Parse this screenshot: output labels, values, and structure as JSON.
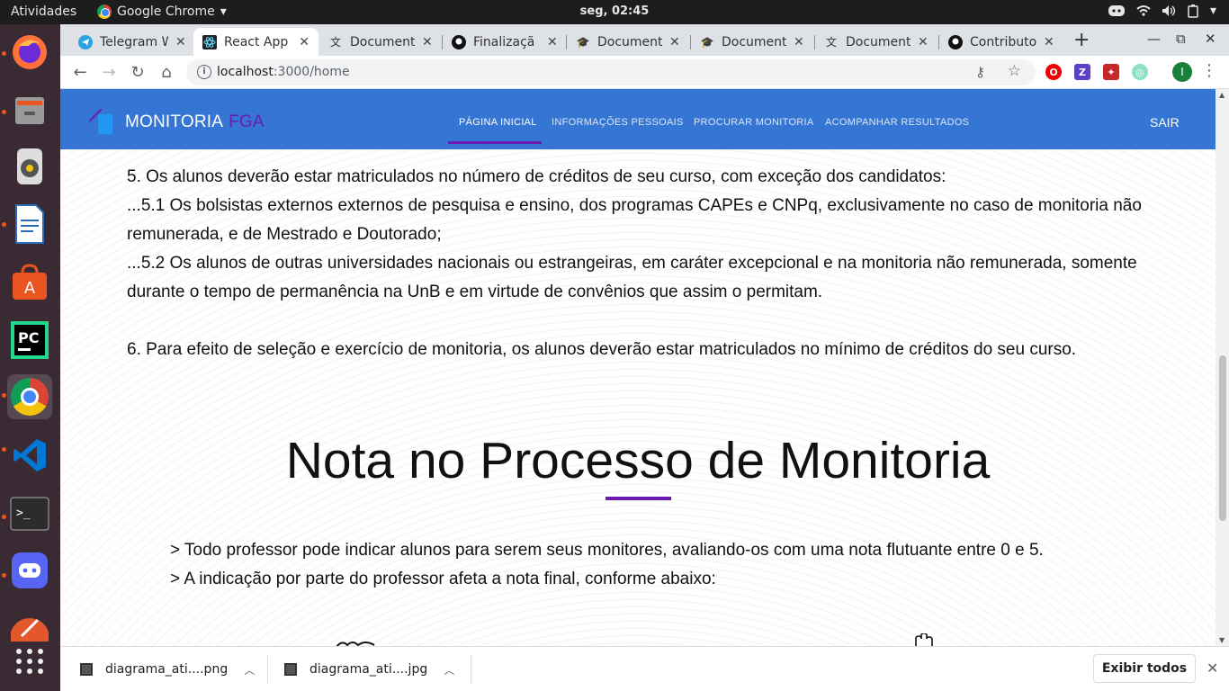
{
  "system": {
    "activities": "Atividades",
    "app_menu": "Google Chrome",
    "clock": "seg, 02:45"
  },
  "dock": {
    "apps": [
      "firefox",
      "files",
      "rhythmbox",
      "libreoffice-writer",
      "ubuntu-software",
      "pycharm",
      "google-chrome",
      "vscode",
      "terminal",
      "discord",
      "inkscape"
    ],
    "show_apps": "show-applications"
  },
  "browser": {
    "tabs": [
      {
        "title": "Telegram W",
        "icon": "telegram-icon"
      },
      {
        "title": "React App",
        "icon": "react-icon",
        "active": true
      },
      {
        "title": "Document",
        "icon": "translate-icon"
      },
      {
        "title": "Finalizaçã",
        "icon": "github-icon"
      },
      {
        "title": "Document",
        "icon": "graduation-cap-icon"
      },
      {
        "title": "Document",
        "icon": "graduation-cap-icon"
      },
      {
        "title": "Document",
        "icon": "translate-icon"
      },
      {
        "title": "Contributo",
        "icon": "github-icon"
      }
    ],
    "url_host": "localhost",
    "url_path": ":3000/home",
    "profile_initial": "I"
  },
  "site": {
    "brand": "MONITORIA",
    "brand_accent": "FGA",
    "nav": [
      "PÁGINA INICIAL",
      "INFORMAÇÕES PESSOAIS",
      "PROCURAR MONITORIA",
      "ACOMPANHAR RESULTADOS"
    ],
    "logout": "SAIR",
    "rules": [
      "5. Os alunos deverão estar matriculados no número de créditos de seu curso, com exceção dos candidatos:",
      "...5.1 Os bolsistas externos externos de pesquisa e ensino, dos programas CAPEs e CNPq, exclusivamente no caso de monitoria não remunerada, e de Mestrado e Doutorado;",
      "...5.2 Os alunos de outras universidades nacionais ou estrangeiras, em caráter excepcional e na monitoria não remunerada, somente durante o tempo de permanência na UnB e em virtude de convênios que assim o permitam.",
      "6. Para efeito de seleção e exercício de monitoria, os alunos deverão estar matriculados no mínimo de créditos do seu curso."
    ],
    "section_title": "Nota no Processo de Monitoria",
    "notes": [
      "> Todo professor pode indicar alunos para serem seus monitores, avaliando-os com uma nota flutuante entre 0 e 5.",
      "> A indicação por parte do professor afeta a nota final, conforme abaixo:"
    ],
    "colors": {
      "navbar": "#3575d3",
      "accent": "#6a1bb2"
    }
  },
  "downloads": {
    "items": [
      "diagrama_ati....png",
      "diagrama_ati....jpg"
    ],
    "show_all": "Exibir todos"
  }
}
